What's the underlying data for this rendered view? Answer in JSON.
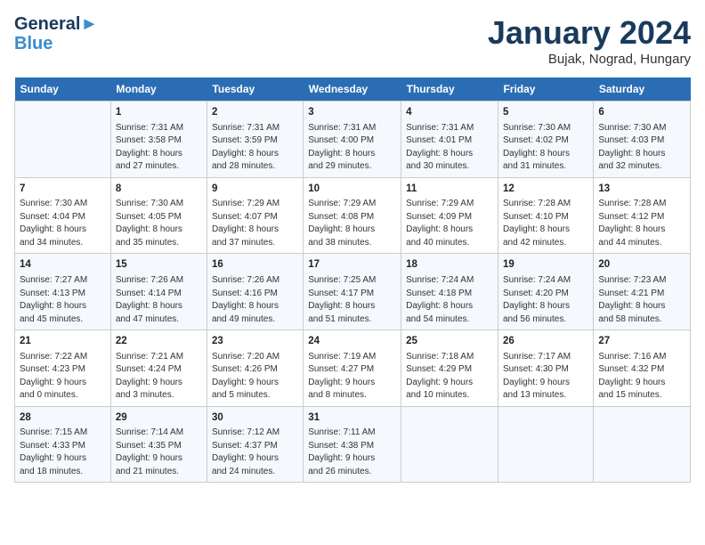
{
  "header": {
    "logo_line1": "General",
    "logo_line2": "Blue",
    "month": "January 2024",
    "location": "Bujak, Nograd, Hungary"
  },
  "weekdays": [
    "Sunday",
    "Monday",
    "Tuesday",
    "Wednesday",
    "Thursday",
    "Friday",
    "Saturday"
  ],
  "rows": [
    [
      {
        "day": "",
        "text": ""
      },
      {
        "day": "1",
        "text": "Sunrise: 7:31 AM\nSunset: 3:58 PM\nDaylight: 8 hours\nand 27 minutes."
      },
      {
        "day": "2",
        "text": "Sunrise: 7:31 AM\nSunset: 3:59 PM\nDaylight: 8 hours\nand 28 minutes."
      },
      {
        "day": "3",
        "text": "Sunrise: 7:31 AM\nSunset: 4:00 PM\nDaylight: 8 hours\nand 29 minutes."
      },
      {
        "day": "4",
        "text": "Sunrise: 7:31 AM\nSunset: 4:01 PM\nDaylight: 8 hours\nand 30 minutes."
      },
      {
        "day": "5",
        "text": "Sunrise: 7:30 AM\nSunset: 4:02 PM\nDaylight: 8 hours\nand 31 minutes."
      },
      {
        "day": "6",
        "text": "Sunrise: 7:30 AM\nSunset: 4:03 PM\nDaylight: 8 hours\nand 32 minutes."
      }
    ],
    [
      {
        "day": "7",
        "text": "Sunrise: 7:30 AM\nSunset: 4:04 PM\nDaylight: 8 hours\nand 34 minutes."
      },
      {
        "day": "8",
        "text": "Sunrise: 7:30 AM\nSunset: 4:05 PM\nDaylight: 8 hours\nand 35 minutes."
      },
      {
        "day": "9",
        "text": "Sunrise: 7:29 AM\nSunset: 4:07 PM\nDaylight: 8 hours\nand 37 minutes."
      },
      {
        "day": "10",
        "text": "Sunrise: 7:29 AM\nSunset: 4:08 PM\nDaylight: 8 hours\nand 38 minutes."
      },
      {
        "day": "11",
        "text": "Sunrise: 7:29 AM\nSunset: 4:09 PM\nDaylight: 8 hours\nand 40 minutes."
      },
      {
        "day": "12",
        "text": "Sunrise: 7:28 AM\nSunset: 4:10 PM\nDaylight: 8 hours\nand 42 minutes."
      },
      {
        "day": "13",
        "text": "Sunrise: 7:28 AM\nSunset: 4:12 PM\nDaylight: 8 hours\nand 44 minutes."
      }
    ],
    [
      {
        "day": "14",
        "text": "Sunrise: 7:27 AM\nSunset: 4:13 PM\nDaylight: 8 hours\nand 45 minutes."
      },
      {
        "day": "15",
        "text": "Sunrise: 7:26 AM\nSunset: 4:14 PM\nDaylight: 8 hours\nand 47 minutes."
      },
      {
        "day": "16",
        "text": "Sunrise: 7:26 AM\nSunset: 4:16 PM\nDaylight: 8 hours\nand 49 minutes."
      },
      {
        "day": "17",
        "text": "Sunrise: 7:25 AM\nSunset: 4:17 PM\nDaylight: 8 hours\nand 51 minutes."
      },
      {
        "day": "18",
        "text": "Sunrise: 7:24 AM\nSunset: 4:18 PM\nDaylight: 8 hours\nand 54 minutes."
      },
      {
        "day": "19",
        "text": "Sunrise: 7:24 AM\nSunset: 4:20 PM\nDaylight: 8 hours\nand 56 minutes."
      },
      {
        "day": "20",
        "text": "Sunrise: 7:23 AM\nSunset: 4:21 PM\nDaylight: 8 hours\nand 58 minutes."
      }
    ],
    [
      {
        "day": "21",
        "text": "Sunrise: 7:22 AM\nSunset: 4:23 PM\nDaylight: 9 hours\nand 0 minutes."
      },
      {
        "day": "22",
        "text": "Sunrise: 7:21 AM\nSunset: 4:24 PM\nDaylight: 9 hours\nand 3 minutes."
      },
      {
        "day": "23",
        "text": "Sunrise: 7:20 AM\nSunset: 4:26 PM\nDaylight: 9 hours\nand 5 minutes."
      },
      {
        "day": "24",
        "text": "Sunrise: 7:19 AM\nSunset: 4:27 PM\nDaylight: 9 hours\nand 8 minutes."
      },
      {
        "day": "25",
        "text": "Sunrise: 7:18 AM\nSunset: 4:29 PM\nDaylight: 9 hours\nand 10 minutes."
      },
      {
        "day": "26",
        "text": "Sunrise: 7:17 AM\nSunset: 4:30 PM\nDaylight: 9 hours\nand 13 minutes."
      },
      {
        "day": "27",
        "text": "Sunrise: 7:16 AM\nSunset: 4:32 PM\nDaylight: 9 hours\nand 15 minutes."
      }
    ],
    [
      {
        "day": "28",
        "text": "Sunrise: 7:15 AM\nSunset: 4:33 PM\nDaylight: 9 hours\nand 18 minutes."
      },
      {
        "day": "29",
        "text": "Sunrise: 7:14 AM\nSunset: 4:35 PM\nDaylight: 9 hours\nand 21 minutes."
      },
      {
        "day": "30",
        "text": "Sunrise: 7:12 AM\nSunset: 4:37 PM\nDaylight: 9 hours\nand 24 minutes."
      },
      {
        "day": "31",
        "text": "Sunrise: 7:11 AM\nSunset: 4:38 PM\nDaylight: 9 hours\nand 26 minutes."
      },
      {
        "day": "",
        "text": ""
      },
      {
        "day": "",
        "text": ""
      },
      {
        "day": "",
        "text": ""
      }
    ]
  ]
}
